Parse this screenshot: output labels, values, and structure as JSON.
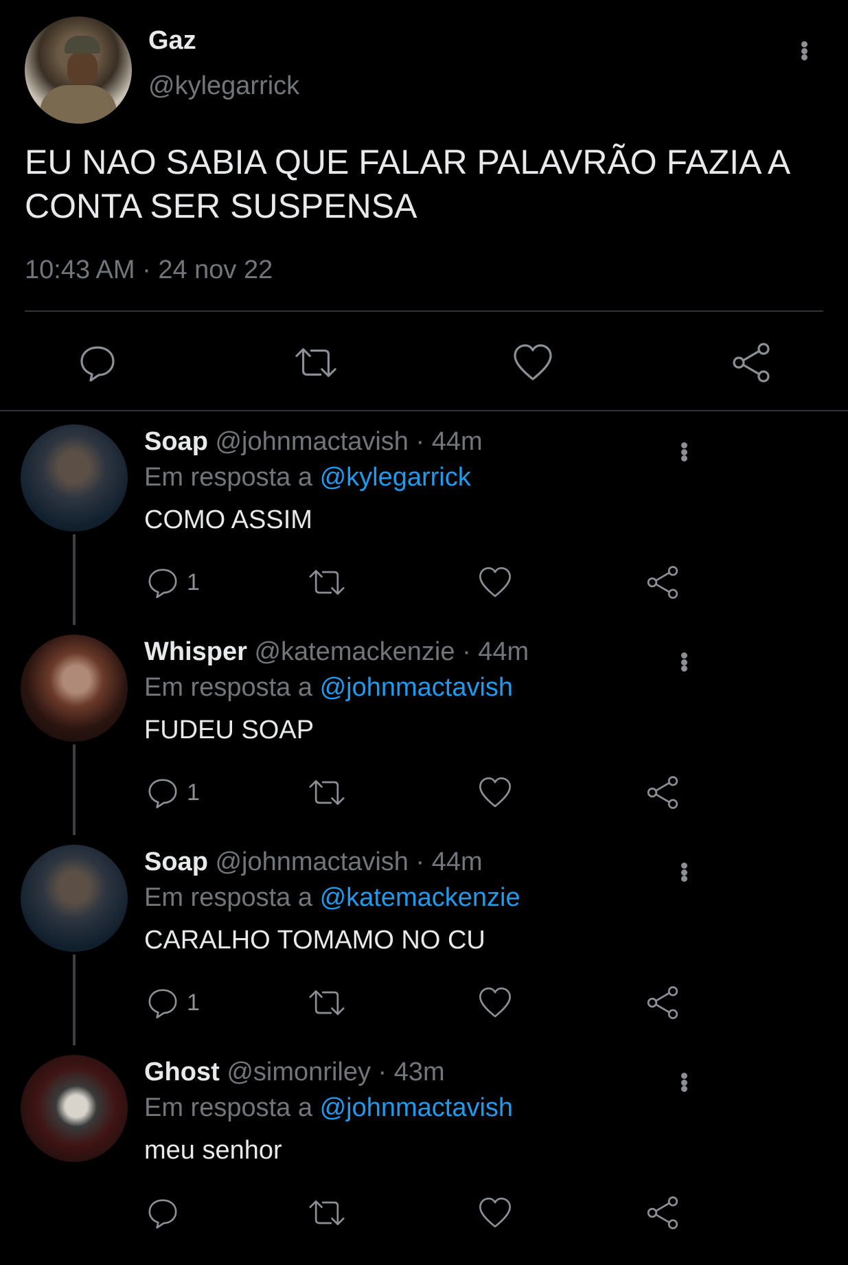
{
  "tweet": {
    "author_name": "Gaz",
    "author_handle": "@kylegarrick",
    "text": "EU NAO SABIA QUE FALAR PALAVRÃO FAZIA A CONTA SER SUSPENSA",
    "timestamp": "10:43 AM · 24 nov 22"
  },
  "icons": {
    "reply": "reply-icon",
    "retweet": "retweet-icon",
    "like": "heart-icon",
    "share": "share-icon",
    "more": "more-vertical-icon"
  },
  "colors": {
    "background": "#000000",
    "text": "#e7e9ea",
    "muted": "#71767b",
    "link": "#1d9bf0",
    "divider": "#2f3336"
  },
  "replies": [
    {
      "name": "Soap",
      "handle": "@johnmactavish",
      "time": "· 44m",
      "reply_prefix": "Em resposta a",
      "reply_to": "@kylegarrick",
      "text": "COMO ASSIM",
      "reply_count": "1"
    },
    {
      "name": "Whisper",
      "handle": "@katemackenzie",
      "time": "· 44m",
      "reply_prefix": "Em resposta a",
      "reply_to": "@johnmactavish",
      "text": "FUDEU SOAP",
      "reply_count": "1"
    },
    {
      "name": "Soap",
      "handle": "@johnmactavish",
      "time": "· 44m",
      "reply_prefix": "Em resposta a",
      "reply_to": "@katemackenzie",
      "text": "CARALHO TOMAMO NO CU",
      "reply_count": "1"
    },
    {
      "name": "Ghost",
      "handle": "@simonriley",
      "time": "· 43m",
      "reply_prefix": "Em resposta a",
      "reply_to": "@johnmactavish",
      "text": "meu senhor",
      "reply_count": ""
    }
  ]
}
